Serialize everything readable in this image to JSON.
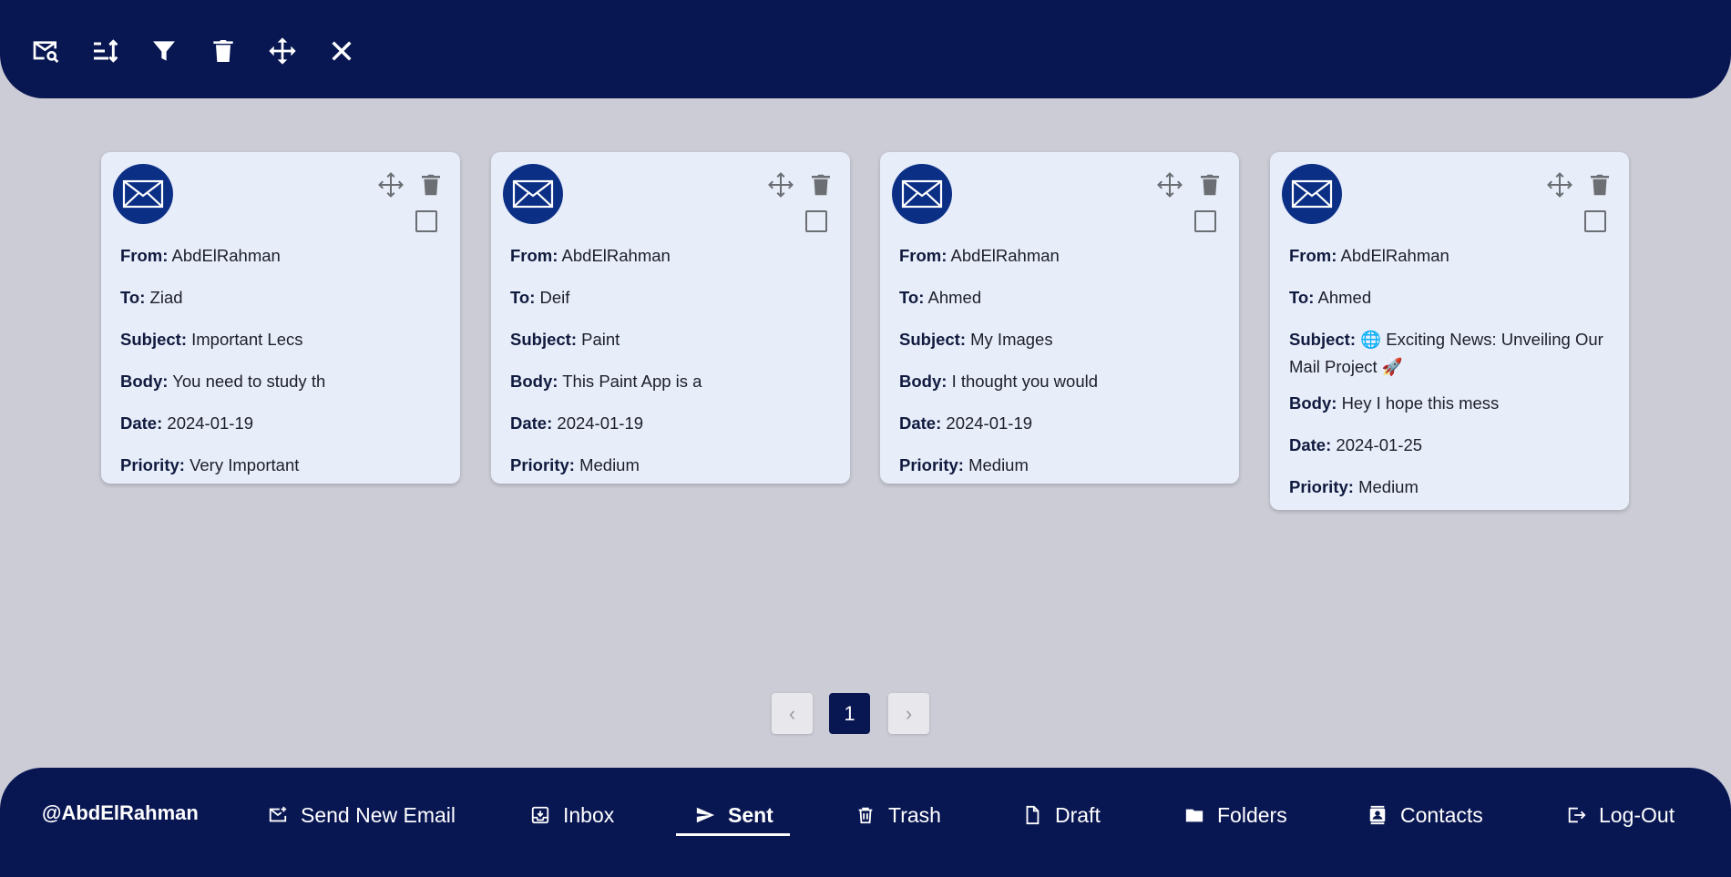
{
  "toolbar": {
    "icons": [
      "search-mail-icon",
      "sort-icon",
      "filter-icon",
      "trash-icon",
      "move-icon",
      "close-icon"
    ]
  },
  "emails": [
    {
      "from_label": "From:",
      "from": "AbdElRahman",
      "to_label": "To:",
      "to": "Ziad",
      "subject_label": "Subject:",
      "subject": "Important Lecs",
      "body_label": "Body:",
      "body": "You need to study th",
      "date_label": "Date:",
      "date": "2024-01-19",
      "priority_label": "Priority:",
      "priority": "Very Important"
    },
    {
      "from_label": "From:",
      "from": "AbdElRahman",
      "to_label": "To:",
      "to": "Deif",
      "subject_label": "Subject:",
      "subject": "Paint",
      "body_label": "Body:",
      "body": "This Paint App is a",
      "date_label": "Date:",
      "date": "2024-01-19",
      "priority_label": "Priority:",
      "priority": "Medium"
    },
    {
      "from_label": "From:",
      "from": "AbdElRahman",
      "to_label": "To:",
      "to": "Ahmed",
      "subject_label": "Subject:",
      "subject": "My Images",
      "body_label": "Body:",
      "body": "I thought you would",
      "date_label": "Date:",
      "date": "2024-01-19",
      "priority_label": "Priority:",
      "priority": "Medium"
    },
    {
      "from_label": "From:",
      "from": "AbdElRahman",
      "to_label": "To:",
      "to": "Ahmed",
      "subject_label": "Subject:",
      "subject": "🌐 Exciting News: Unveiling Our Mail Project 🚀",
      "body_label": "Body:",
      "body": "Hey I hope this mess",
      "date_label": "Date:",
      "date": "2024-01-25",
      "priority_label": "Priority:",
      "priority": "Medium"
    }
  ],
  "pagination": {
    "prev": "‹",
    "current": "1",
    "next": "›"
  },
  "nav": {
    "username": "@AbdElRahman",
    "items": [
      {
        "label": "Send New Email",
        "icon": "compose-icon"
      },
      {
        "label": "Inbox",
        "icon": "inbox-icon"
      },
      {
        "label": "Sent",
        "icon": "send-icon"
      },
      {
        "label": "Trash",
        "icon": "trash-icon"
      },
      {
        "label": "Draft",
        "icon": "draft-icon"
      },
      {
        "label": "Folders",
        "icon": "folder-icon"
      },
      {
        "label": "Contacts",
        "icon": "contacts-icon"
      },
      {
        "label": "Log-Out",
        "icon": "logout-icon"
      }
    ],
    "active": "Sent"
  },
  "colors": {
    "primary": "#081652",
    "background": "#cbccd6",
    "card": "#e7edf9",
    "avatar": "#0c2f86"
  }
}
